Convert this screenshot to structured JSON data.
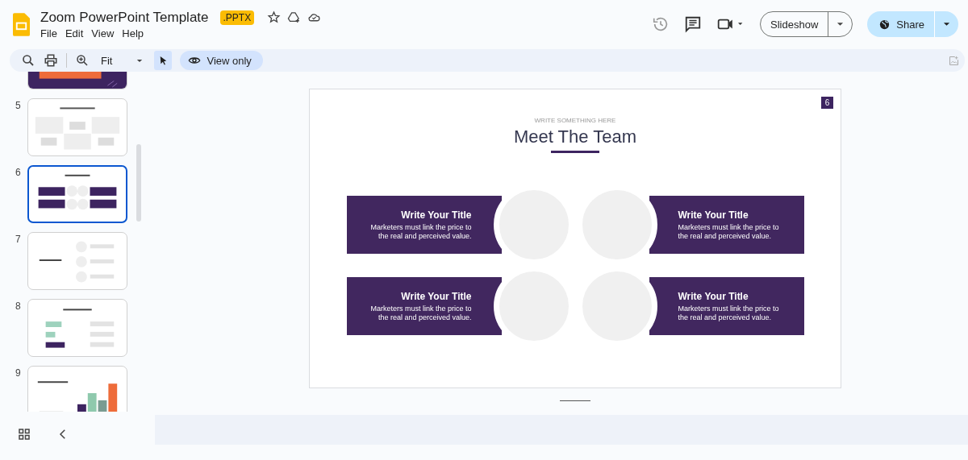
{
  "document": {
    "title": "Zoom PowerPoint Template",
    "badge": ".PPTX",
    "menu": [
      "File",
      "Edit",
      "View",
      "Help"
    ]
  },
  "header": {
    "slideshow": "Slideshow",
    "share": "Share"
  },
  "toolbar": {
    "zoom": "Fit",
    "view_only": "View only"
  },
  "thumbnails": [
    {
      "kind": "cover",
      "selected": false
    },
    {
      "number": "5",
      "kind": "portfolio",
      "selected": false
    },
    {
      "number": "6",
      "kind": "team-grid",
      "selected": true
    },
    {
      "number": "7",
      "kind": "team-list",
      "selected": false
    },
    {
      "number": "8",
      "kind": "survey",
      "selected": false
    },
    {
      "number": "9",
      "kind": "kpi",
      "selected": false
    }
  ],
  "slide": {
    "number": "6",
    "eyebrow": "WRITE SOMETHING HERE",
    "title": "Meet The Team",
    "members": [
      {
        "title": "Write Your Title",
        "text": "Marketers must link the price to the real and perceived value."
      },
      {
        "title": "Write Your Title",
        "text": "Marketers must link the price to the real and perceived value."
      },
      {
        "title": "Write Your Title",
        "text": "Marketers must link the price to the real and perceived value."
      },
      {
        "title": "Write Your Title",
        "text": "Marketers must link the price to the real and perceived value."
      }
    ]
  }
}
